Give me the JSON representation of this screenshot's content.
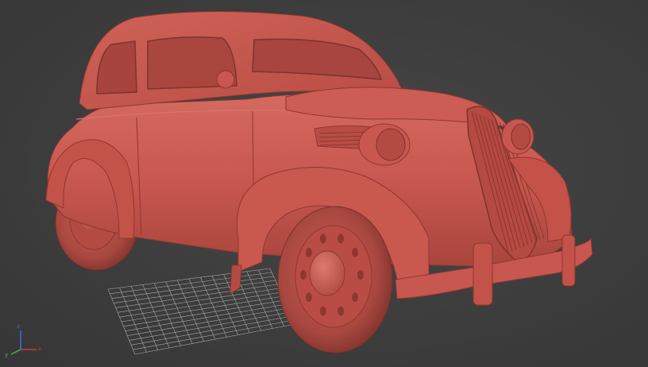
{
  "viewport": {
    "background": "#3c3c3c",
    "model_color": "#c8574f",
    "model_shadow": "#8e3730",
    "model_highlight": "#d8766c",
    "grid_color": "#a9a9a9"
  },
  "axis_gizmo": {
    "x_label": "x",
    "y_label": "y",
    "z_label": "z",
    "x_color": "#d23b2f",
    "y_color": "#44b547",
    "z_color": "#3a6fe0"
  },
  "icons": {
    "model": "vintage-sedan-model-icon",
    "grid": "ground-grid-icon",
    "gizmo": "axis-gizmo-icon"
  }
}
